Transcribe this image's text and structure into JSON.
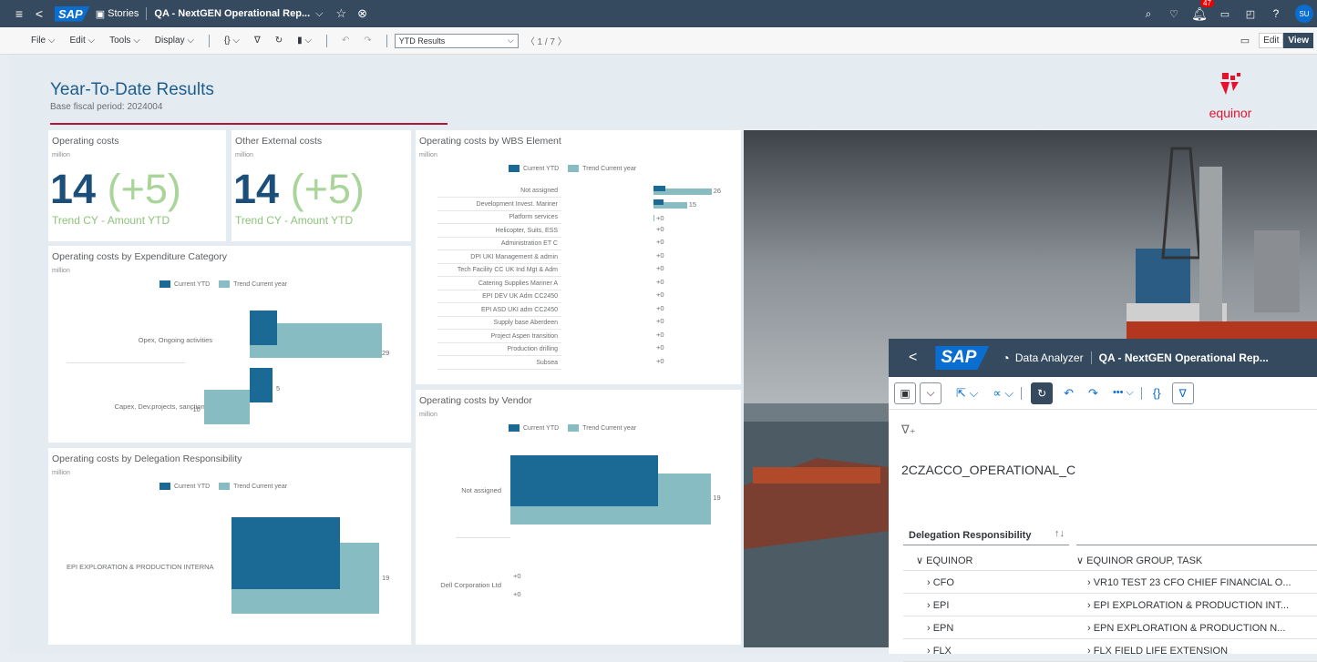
{
  "shell": {
    "back": "<",
    "sap": "SAP",
    "stories_icon": "presentation-icon",
    "stories": "Stories",
    "story_title": "QA - NextGEN Operational Rep...",
    "notif_count": "47",
    "avatar": "SU"
  },
  "toolbar": {
    "file": "File ⌵",
    "edit": "Edit ⌵",
    "tools": "Tools ⌵",
    "display": "Display ⌵",
    "braces": "{} ⌵",
    "filter": "∇",
    "refresh": "↻",
    "bookmark": "▮ ⌵",
    "undo": "↶",
    "redo": "↷",
    "page_select": "YTD Results",
    "paging": "〈  1 / 7  〉",
    "edit_btn": "Edit",
    "view_btn": "View"
  },
  "header": {
    "title": "Year-To-Date Results",
    "subtitle": "Base fiscal period: 2024004",
    "logo_text": "equinor"
  },
  "kpi1": {
    "title": "Operating costs",
    "unit": "million",
    "value": "14",
    "delta": "(+5)",
    "caption": "Trend CY - Amount YTD"
  },
  "kpi2": {
    "title": "Other External costs",
    "unit": "million",
    "value": "14",
    "delta": "(+5)",
    "caption": "Trend CY - Amount YTD"
  },
  "legend": {
    "a": "Current YTD",
    "b": "Trend Current year"
  },
  "colors": {
    "current": "#1a6a95",
    "trend": "#86bcc2",
    "shell": "#354a5f",
    "accent": "#b0153c"
  },
  "chart_data": [
    {
      "type": "bar",
      "title": "Operating costs by Expenditure Category",
      "unit": "million",
      "categories": [
        "Opex, Ongoing activities",
        "Capex, Dev.projects, sanctioned"
      ],
      "series": [
        {
          "name": "Current YTD",
          "values": [
            6,
            5
          ]
        },
        {
          "name": "Trend Current year",
          "values": [
            29,
            -10
          ]
        }
      ],
      "data_labels": [
        "29",
        "5",
        "-10"
      ]
    },
    {
      "type": "bar",
      "title": "Operating costs by Delegation Responsibility",
      "unit": "million",
      "categories": [
        "EPI EXPLORATION & PRODUCTION INTERNA"
      ],
      "series": [
        {
          "name": "Current YTD",
          "values": [
            14
          ]
        },
        {
          "name": "Trend Current year",
          "values": [
            19
          ]
        }
      ],
      "data_labels": [
        "19"
      ]
    },
    {
      "type": "bar",
      "title": "Operating costs by WBS Element",
      "unit": "million",
      "categories": [
        "Not assigned",
        "Development Invest. Mariner",
        "Platform services",
        "Helicopter, Suits, ESS",
        "Administration ET C",
        "DPI UKI Management & admin",
        "Tech Facility CC UK Ind Mgt & Adm",
        "Catering Supplies Mariner A",
        "EPI DEV UK Adm CC2450",
        "EPI ASD UKI adm CC2450",
        "Supply base Aberdeen",
        "Project Aspen transition",
        "Production drilling",
        "Subsea"
      ],
      "series": [
        {
          "name": "Current YTD",
          "values": [
            5,
            4,
            0,
            0,
            0,
            0,
            0,
            0,
            0,
            0,
            0,
            0,
            0,
            0
          ]
        },
        {
          "name": "Trend Current year",
          "values": [
            26,
            15,
            0,
            0,
            0,
            0,
            0,
            0,
            0,
            0,
            0,
            0,
            0,
            0
          ]
        }
      ],
      "data_labels": [
        "26",
        "15",
        "+0",
        "+0",
        "+0",
        "+0",
        "+0",
        "+0",
        "+0",
        "+0",
        "+0",
        "+0",
        "+0",
        "+0"
      ]
    },
    {
      "type": "bar",
      "title": "Operating costs by Vendor",
      "unit": "million",
      "categories": [
        "Not assigned",
        "Dell Corporation Ltd"
      ],
      "series": [
        {
          "name": "Current YTD",
          "values": [
            14,
            0
          ]
        },
        {
          "name": "Trend Current year",
          "values": [
            19,
            0
          ]
        }
      ],
      "data_labels": [
        "19",
        "+0",
        "+0"
      ]
    }
  ],
  "analyzer": {
    "back": "<",
    "sap": "SAP",
    "app": "Data Analyzer",
    "title": "QA - NextGEN Operational Rep...",
    "query": "2CZACCO_OPERATIONAL_C",
    "col_header": "Delegation Responsibility",
    "sort": "↑↓",
    "rows": [
      {
        "a": "∨ EQUINOR",
        "b": "∨ EQUINOR GROUP, TASK"
      },
      {
        "a": "› CFO",
        "b": "› VR10 TEST 23 CFO CHIEF FINANCIAL O..."
      },
      {
        "a": "› EPI",
        "b": "› EPI EXPLORATION & PRODUCTION INT..."
      },
      {
        "a": "› EPN",
        "b": "› EPN EXPLORATION & PRODUCTION N..."
      },
      {
        "a": "› FLX",
        "b": "› FLX FIELD LIFE EXTENSION"
      }
    ]
  }
}
